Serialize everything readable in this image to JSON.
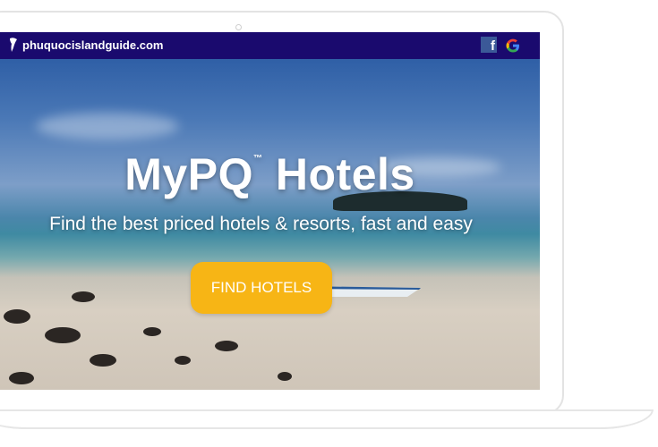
{
  "header": {
    "site_name": "phuquocislandguide.com",
    "facebook_icon": "facebook-icon",
    "google_icon": "google-icon"
  },
  "hero": {
    "title": "MyPQ",
    "trademark": "™",
    "title_suffix": "Hotels",
    "tagline": "Find the best priced hotels & resorts, fast and easy",
    "cta_label": "FIND HOTELS"
  },
  "colors": {
    "topbar": "#1a0a6e",
    "cta": "#f7b515",
    "facebook": "#3b5998"
  }
}
